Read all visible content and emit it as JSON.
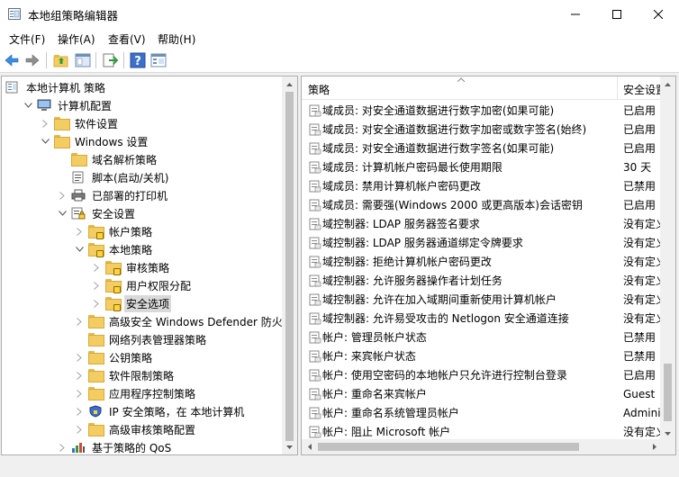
{
  "window": {
    "title": "本地组策略编辑器"
  },
  "menubar": {
    "items": [
      "文件(F)",
      "操作(A)",
      "查看(V)",
      "帮助(H)"
    ]
  },
  "tree": [
    {
      "label": "本地计算机 策略",
      "level": 0,
      "arrow": "",
      "icon": "policy"
    },
    {
      "label": "计算机配置",
      "level": 1,
      "arrow": "down",
      "icon": "computer"
    },
    {
      "label": "软件设置",
      "level": 2,
      "arrow": "right",
      "icon": "folder"
    },
    {
      "label": "Windows 设置",
      "level": 2,
      "arrow": "down",
      "icon": "folder"
    },
    {
      "label": "域名解析策略",
      "level": 3,
      "arrow": "",
      "icon": "folder"
    },
    {
      "label": "脚本(启动/关机)",
      "level": 3,
      "arrow": "",
      "icon": "script"
    },
    {
      "label": "已部署的打印机",
      "level": 3,
      "arrow": "right",
      "icon": "printer"
    },
    {
      "label": "安全设置",
      "level": 3,
      "arrow": "down",
      "icon": "security"
    },
    {
      "label": "帐户策略",
      "level": 4,
      "arrow": "right",
      "icon": "lockfolder"
    },
    {
      "label": "本地策略",
      "level": 4,
      "arrow": "down",
      "icon": "lockfolder"
    },
    {
      "label": "审核策略",
      "level": 5,
      "arrow": "right",
      "icon": "lockfolder"
    },
    {
      "label": "用户权限分配",
      "level": 5,
      "arrow": "right",
      "icon": "lockfolder"
    },
    {
      "label": "安全选项",
      "level": 5,
      "arrow": "right",
      "icon": "lockfolder",
      "selected": true
    },
    {
      "label": "高级安全 Windows Defender 防火墙",
      "level": 4,
      "arrow": "right",
      "icon": "folder"
    },
    {
      "label": "网络列表管理器策略",
      "level": 4,
      "arrow": "",
      "icon": "folder"
    },
    {
      "label": "公钥策略",
      "level": 4,
      "arrow": "right",
      "icon": "folder"
    },
    {
      "label": "软件限制策略",
      "level": 4,
      "arrow": "right",
      "icon": "folder"
    },
    {
      "label": "应用程序控制策略",
      "level": 4,
      "arrow": "right",
      "icon": "folder"
    },
    {
      "label": "IP 安全策略，在 本地计算机",
      "level": 4,
      "arrow": "right",
      "icon": "ipsec"
    },
    {
      "label": "高级审核策略配置",
      "level": 4,
      "arrow": "right",
      "icon": "folder"
    },
    {
      "label": "基于策略的 QoS",
      "level": 3,
      "arrow": "right",
      "icon": "qos"
    }
  ],
  "list": {
    "col_policy": "策略",
    "col_setting": "安全设置",
    "rows": [
      {
        "name": "域成员: 对安全通道数据进行数字加密(如果可能)",
        "value": "已启用"
      },
      {
        "name": "域成员: 对安全通道数据进行数字加密或数字签名(始终)",
        "value": "已启用"
      },
      {
        "name": "域成员: 对安全通道数据进行数字签名(如果可能)",
        "value": "已启用"
      },
      {
        "name": "域成员: 计算机帐户密码最长使用期限",
        "value": "30 天"
      },
      {
        "name": "域成员: 禁用计算机帐户密码更改",
        "value": "已禁用"
      },
      {
        "name": "域成员: 需要强(Windows 2000 或更高版本)会话密钥",
        "value": "已启用"
      },
      {
        "name": "域控制器: LDAP 服务器签名要求",
        "value": "没有定义"
      },
      {
        "name": "域控制器: LDAP 服务器通道绑定令牌要求",
        "value": "没有定义"
      },
      {
        "name": "域控制器: 拒绝计算机帐户密码更改",
        "value": "没有定义"
      },
      {
        "name": "域控制器: 允许服务器操作者计划任务",
        "value": "没有定义"
      },
      {
        "name": "域控制器:   允许在加入域期间重新使用计算机帐户",
        "value": "没有定义"
      },
      {
        "name": "域控制器:   允许易受攻击的 Netlogon 安全通道连接",
        "value": "没有定义"
      },
      {
        "name": "帐户: 管理员帐户状态",
        "value": "已禁用"
      },
      {
        "name": "帐户: 来宾帐户状态",
        "value": "已禁用"
      },
      {
        "name": "帐户: 使用空密码的本地帐户只允许进行控制台登录",
        "value": "已启用"
      },
      {
        "name": "帐户: 重命名来宾帐户",
        "value": "Guest"
      },
      {
        "name": "帐户: 重命名系统管理员帐户",
        "value": "Administrator"
      },
      {
        "name": "帐户: 阻止 Microsoft 帐户",
        "value": "没有定义"
      }
    ]
  },
  "colors": {
    "folder": "#f3cd61",
    "accent": "#0078d7"
  }
}
